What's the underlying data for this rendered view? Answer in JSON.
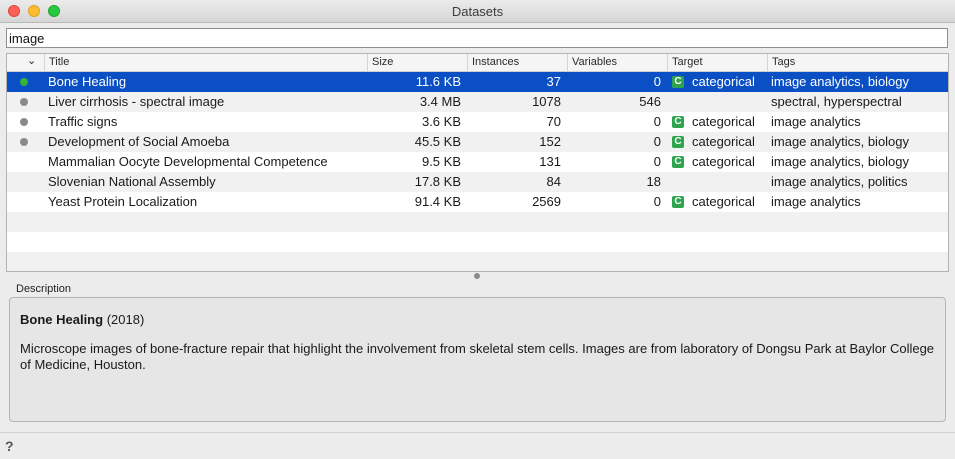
{
  "window": {
    "title": "Datasets"
  },
  "search": {
    "value": "image",
    "placeholder": ""
  },
  "table": {
    "sort_indicator": "⌄",
    "columns": [
      "",
      "Title",
      "Size",
      "Instances",
      "Variables",
      "Target",
      "Tags"
    ],
    "rows": [
      {
        "status": "green",
        "title": "Bone Healing",
        "size": "11.6 KB",
        "instances": "37",
        "variables": "0",
        "target_badge": "C",
        "target": "categorical",
        "tags": "image analytics, biology",
        "selected": true
      },
      {
        "status": "gray",
        "title": "Liver cirrhosis - spectral image",
        "size": "3.4 MB",
        "instances": "1078",
        "variables": "546",
        "target_badge": "",
        "target": "",
        "tags": "spectral, hyperspectral",
        "selected": false
      },
      {
        "status": "gray",
        "title": "Traffic signs",
        "size": "3.6 KB",
        "instances": "70",
        "variables": "0",
        "target_badge": "C",
        "target": "categorical",
        "tags": "image analytics",
        "selected": false
      },
      {
        "status": "gray",
        "title": "Development of Social Amoeba",
        "size": "45.5 KB",
        "instances": "152",
        "variables": "0",
        "target_badge": "C",
        "target": "categorical",
        "tags": "image analytics, biology",
        "selected": false
      },
      {
        "status": "none",
        "title": "Mammalian Oocyte Developmental Competence",
        "size": "9.5 KB",
        "instances": "131",
        "variables": "0",
        "target_badge": "C",
        "target": "categorical",
        "tags": "image analytics, biology",
        "selected": false
      },
      {
        "status": "none",
        "title": "Slovenian National Assembly",
        "size": "17.8 KB",
        "instances": "84",
        "variables": "18",
        "target_badge": "",
        "target": "",
        "tags": "image analytics, politics",
        "selected": false
      },
      {
        "status": "none",
        "title": "Yeast Protein Localization",
        "size": "91.4 KB",
        "instances": "2569",
        "variables": "0",
        "target_badge": "C",
        "target": "categorical",
        "tags": "image analytics",
        "selected": false
      }
    ],
    "empty_rows": 3
  },
  "description": {
    "label": "Description",
    "title": "Bone Healing",
    "year": "(2018)",
    "text": "Microscope images of bone-fracture repair that highlight the involvement from skeletal stem cells. Images are from laboratory of Dongsu Park at Baylor College of Medicine, Houston."
  },
  "status_bar": {
    "help_icon": "?"
  },
  "colors": {
    "selection": "#0b4fc5",
    "status_green": "#35b43a",
    "status_gray": "#8a8a8a",
    "badge": "#2fa44f"
  }
}
